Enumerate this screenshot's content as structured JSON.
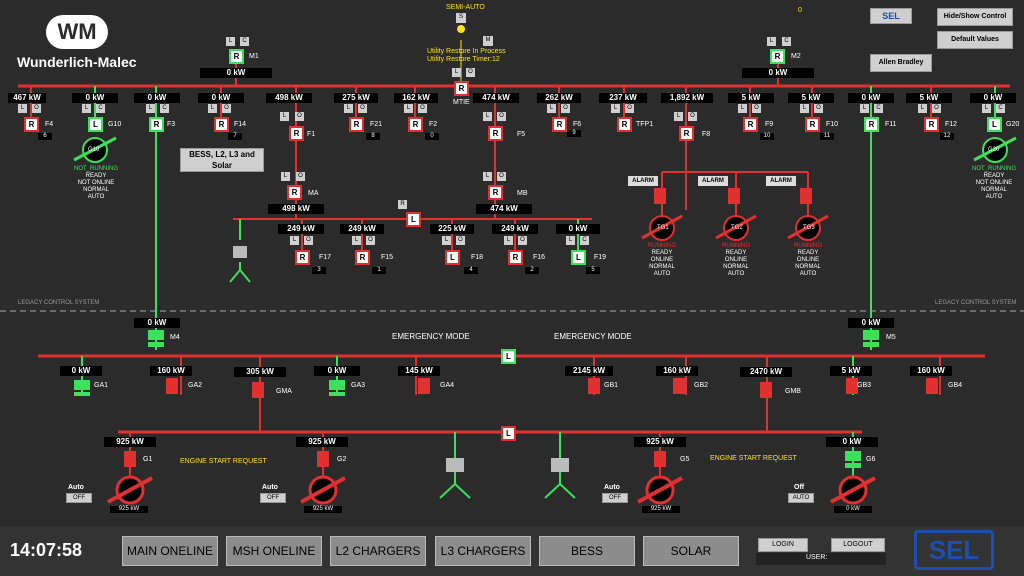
{
  "brand": {
    "logo_text": "WM",
    "name": "Wunderlich-Malec"
  },
  "header": {
    "semi_auto": "SEMI-AUTO",
    "s_btn": "S",
    "m_btn": "M",
    "restore_line1": "Utility Restore In Process",
    "restore_line2": "Utility Restore Timer:",
    "restore_value": "12",
    "top_counter": "0",
    "sel_small": "SEL",
    "hide_show": "Hide/Show Control",
    "defaults": "Default Values",
    "allen_bradley": "Allen Bradley"
  },
  "tags": {
    "l": "L",
    "c": "C",
    "o": "O",
    "r": "R"
  },
  "mains": {
    "m1": {
      "label": "M1",
      "kw": "0 kW"
    },
    "m2": {
      "label": "M2",
      "kw": "0 kW"
    },
    "mtie": {
      "label": "MTIE"
    }
  },
  "feeders": [
    {
      "name": "F4",
      "kw": "467 kW",
      "count": "6"
    },
    {
      "name": "G10",
      "kw": "0 kW"
    },
    {
      "name": "F3",
      "kw": "0 kW"
    },
    {
      "name": "F14",
      "kw": "0 kW",
      "count": "7"
    },
    {
      "name": "F1",
      "kw": "498 kW"
    },
    {
      "name": "F21",
      "kw": "275 kW",
      "count": "8"
    },
    {
      "name": "F2",
      "kw": "162 kW",
      "count": "0"
    },
    {
      "name": "F5",
      "kw": "474 kW"
    },
    {
      "name": "F6",
      "kw": "262 kW",
      "count": "9"
    },
    {
      "name": "TFP1",
      "kw": "237 kW"
    },
    {
      "name": "F8",
      "kw": "1,892 kW"
    },
    {
      "name": "F9",
      "kw": "5 kW",
      "count": "10"
    },
    {
      "name": "F10",
      "kw": "5 kW",
      "count": "11"
    },
    {
      "name": "F11",
      "kw": "0 kW"
    },
    {
      "name": "F12",
      "kw": "5 kW",
      "count": "12"
    },
    {
      "name": "G20",
      "kw": "0 kW"
    }
  ],
  "gens_top": {
    "g10": {
      "label": "G10",
      "lines": [
        "NOT_RUNNING",
        "READY",
        "NOT ONLINE",
        "NORMAL",
        "AUTO"
      ]
    },
    "g20": {
      "label": "G20",
      "lines": [
        "NOT_RUNNING",
        "READY",
        "NOT ONLINE",
        "NORMAL",
        "AUTO"
      ]
    }
  },
  "bess_label": "BESS, L2, L3 and Solar",
  "ma": {
    "label": "MA",
    "kw": "498 kW"
  },
  "mb": {
    "label": "MB",
    "kw": "474 kW"
  },
  "sub_feeders": [
    {
      "name": "F17",
      "kw": "249 kW",
      "count": "3"
    },
    {
      "name": "F15",
      "kw": "249 kW",
      "count": "1"
    },
    {
      "name": "F18",
      "kw": "225 kW",
      "count": "4"
    },
    {
      "name": "F16",
      "kw": "249 kW",
      "count": "2"
    },
    {
      "name": "F19",
      "kw": "0 kW",
      "count": "5"
    }
  ],
  "turbines": [
    {
      "label": "TG1",
      "alarm": "ALARM",
      "lines": [
        "RUNNING",
        "READY",
        "ONLINE",
        "NORMAL",
        "AUTO"
      ]
    },
    {
      "label": "TG2",
      "alarm": "ALARM",
      "lines": [
        "RUNNING",
        "READY",
        "ONLINE",
        "NORMAL",
        "AUTO"
      ]
    },
    {
      "label": "TG3",
      "alarm": "ALARM",
      "lines": [
        "RUNNING",
        "READY",
        "ONLINE",
        "NORMAL",
        "AUTO"
      ]
    }
  ],
  "legacy": "LEGACY CONTROL SYSTEM",
  "emergency": "EMERGENCY MODE",
  "m4": {
    "label": "M4",
    "kw": "0 kW"
  },
  "m5": {
    "label": "M5",
    "kw": "0 kW"
  },
  "ga_gb": [
    {
      "name": "GA1",
      "kw": "0 kW"
    },
    {
      "name": "GA2",
      "kw": "160 kW"
    },
    {
      "name": "GMA",
      "kw": "305 kW"
    },
    {
      "name": "GA3",
      "kw": "0 kW"
    },
    {
      "name": "GA4",
      "kw": "145 kW"
    },
    {
      "name": "GB1",
      "kw": "2145 kW"
    },
    {
      "name": "GB2",
      "kw": "160 kW"
    },
    {
      "name": "GMB",
      "kw": "2470 kW"
    },
    {
      "name": "GB3",
      "kw": "5 kW"
    },
    {
      "name": "GB4",
      "kw": "160 kW"
    }
  ],
  "engines": [
    {
      "name": "G1",
      "kw": "925 kW",
      "mode": "Auto",
      "state": "OFF",
      "out": "925 kW"
    },
    {
      "name": "G2",
      "kw": "925 kW",
      "mode": "Auto",
      "state": "OFF",
      "out": "925 kW"
    },
    {
      "name": "G5",
      "kw": "925 kW",
      "mode": "Auto",
      "state": "OFF",
      "out": "925 kW"
    },
    {
      "name": "G6",
      "kw": "0 kW",
      "mode": "Off",
      "state": "AUTO",
      "out": "0 kW"
    }
  ],
  "engine_start": "ENGINE START REQUEST",
  "footer": {
    "clock": "14:07:58",
    "nav": [
      "MAIN ONELINE",
      "MSH ONELINE",
      "L2 CHARGERS",
      "L3 CHARGERS",
      "BESS",
      "SOLAR"
    ],
    "login": "LOGIN",
    "logout": "LOGOUT",
    "user_label": "USER:",
    "sel_logo": "SEL"
  },
  "colors": {
    "red": "#e03030",
    "green": "#3ce05a",
    "yellow": "#ffe21a",
    "bg": "#2b2b2b"
  }
}
